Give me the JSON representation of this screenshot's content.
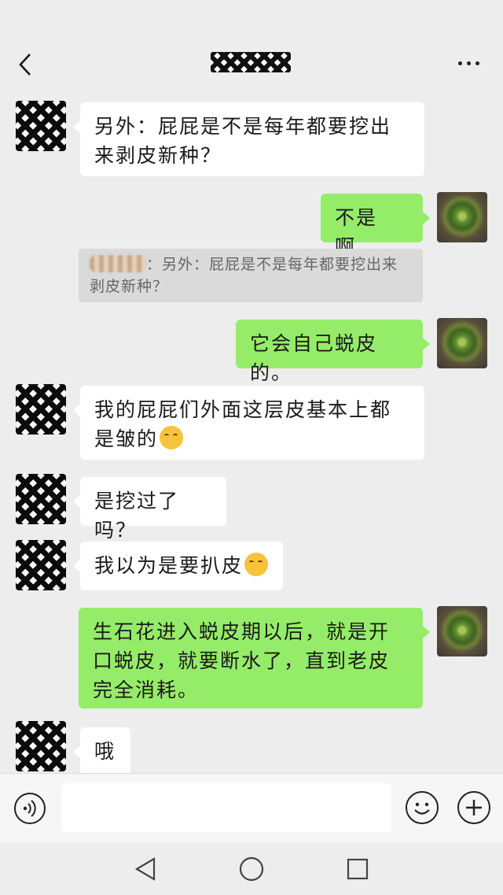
{
  "header": {
    "back_icon": "chevron-left-icon",
    "title": "",
    "more_icon": "more-dots-icon"
  },
  "messages": [
    {
      "from": "peer",
      "text": "另外：屁屁是不是每年都要挖出来剥皮新种？"
    },
    {
      "from": "me",
      "text": "不是啊。"
    },
    {
      "quote_author": "",
      "quote_text": "：另外：屁屁是不是每年都要挖出来剥皮新种？"
    },
    {
      "from": "me",
      "text": "它会自己蜕皮的。"
    },
    {
      "from": "peer",
      "text": "我的屁屁们外面这层皮基本上都是皱的",
      "emoji": "smiling-face-emoji"
    },
    {
      "from": "peer",
      "text": "是挖过了吗？"
    },
    {
      "from": "peer",
      "text": "我以为是要扒皮",
      "emoji": "smiling-face-emoji"
    },
    {
      "from": "me",
      "text": "生石花进入蜕皮期以后，就是开口蜕皮，就要断水了，直到老皮完全消耗。"
    },
    {
      "from": "peer",
      "text": "哦"
    }
  ],
  "input_bar": {
    "voice_icon": "voice-icon",
    "input_value": "",
    "emoji_icon": "emoji-icon",
    "add_icon": "plus-icon"
  },
  "nav": {
    "back_icon": "nav-back-triangle-icon",
    "home_icon": "nav-home-circle-icon",
    "recents_icon": "nav-recents-square-icon"
  },
  "colors": {
    "background": "#ededed",
    "outgoing_bubble": "#95ec69",
    "incoming_bubble": "#ffffff"
  }
}
